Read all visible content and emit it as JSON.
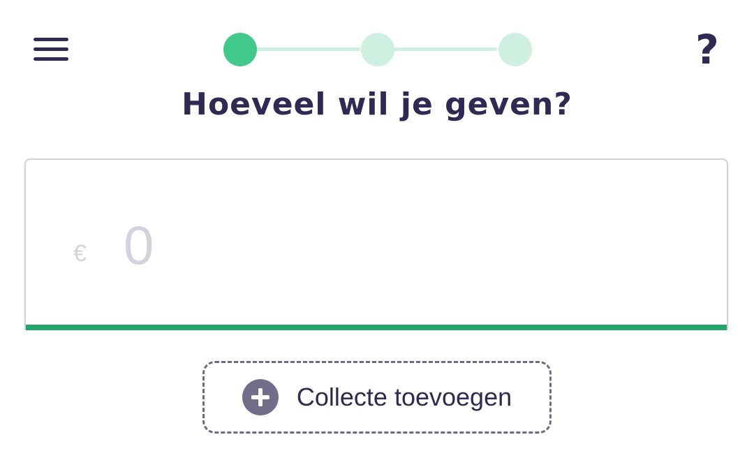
{
  "header": {
    "menu_icon": "hamburger-menu-icon",
    "help_label": "?",
    "steps": {
      "total": 3,
      "current": 1
    }
  },
  "main": {
    "title": "Hoeveel wil je geven?",
    "amount": {
      "currency_symbol": "€",
      "value": "",
      "placeholder": "0"
    },
    "add_collection": {
      "icon": "plus-circle-icon",
      "label": "Collecte toevoegen"
    }
  },
  "colors": {
    "text_primary": "#2e2a54",
    "step_active": "#41c98b",
    "step_inactive": "#cff0e1",
    "input_underline": "#21a56a",
    "placeholder": "#d4d3dc",
    "plus_icon_bg": "#706e88",
    "dashed_border": "#6d6b85"
  }
}
